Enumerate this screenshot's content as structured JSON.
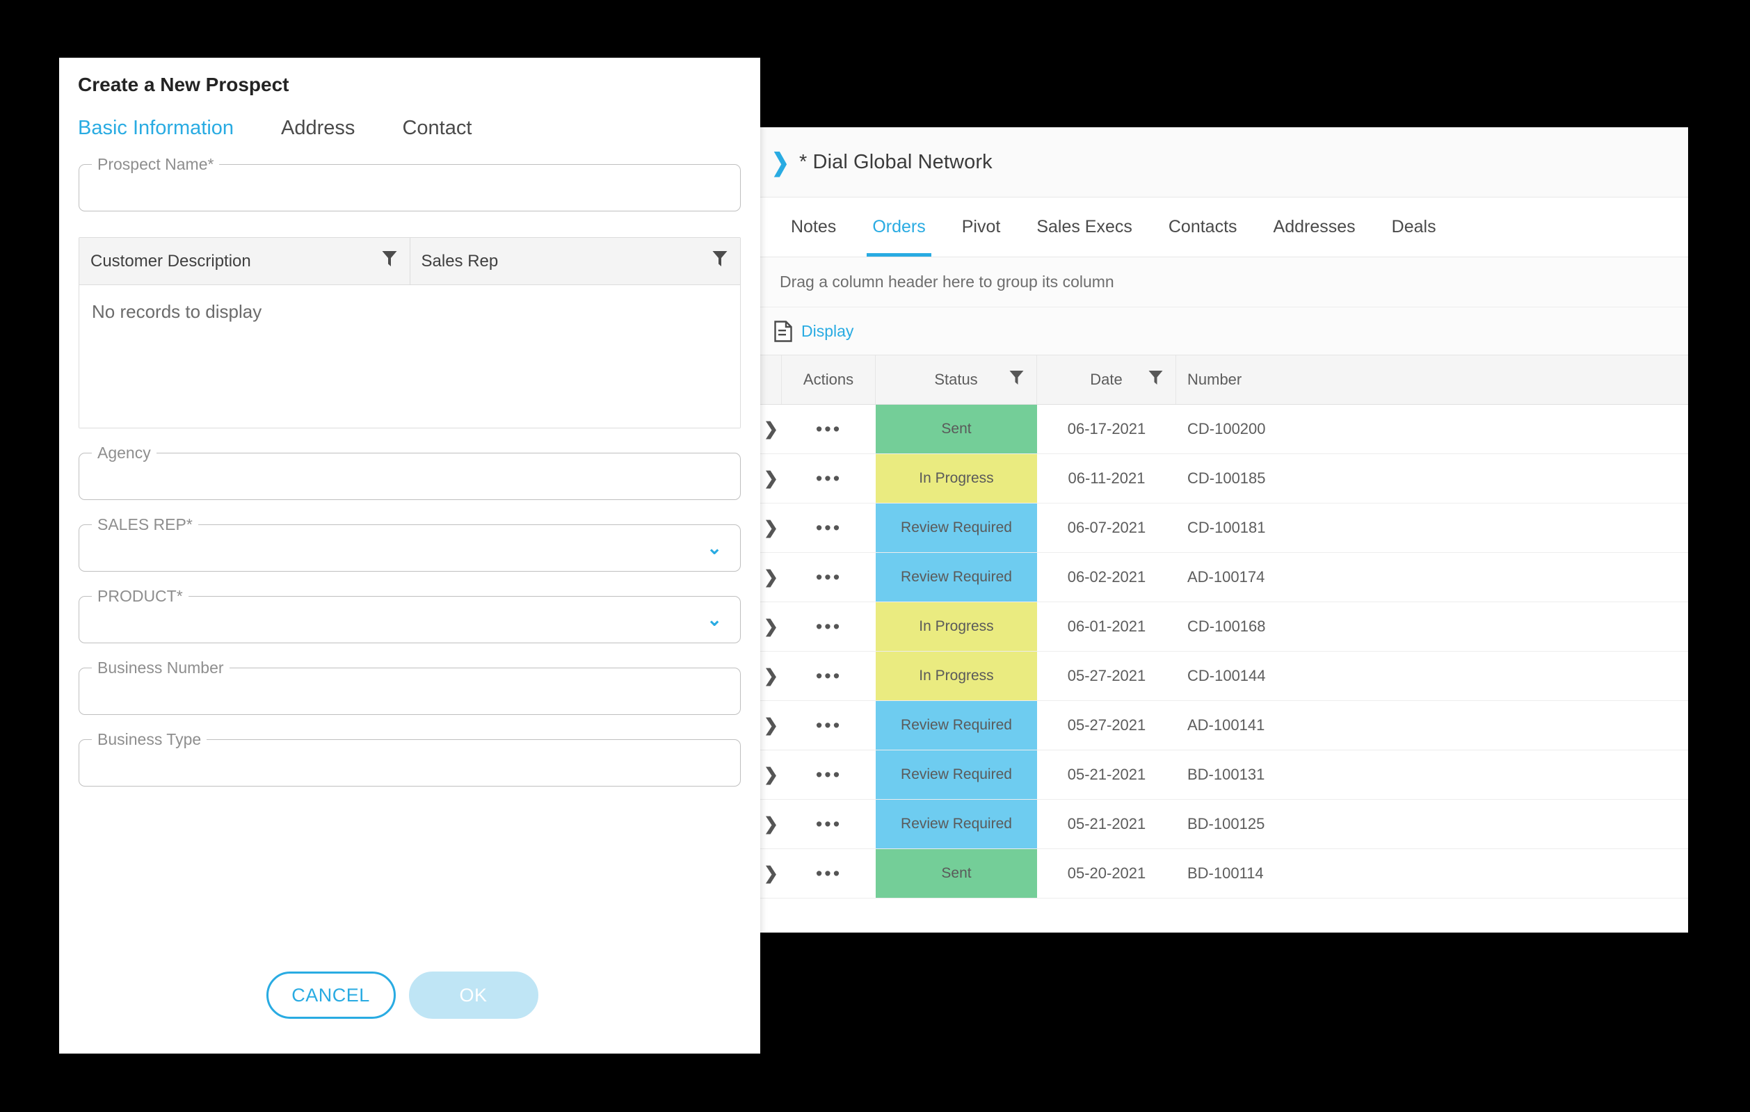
{
  "dialog": {
    "title": "Create a New Prospect",
    "tabs": [
      {
        "label": "Basic Information",
        "active": true
      },
      {
        "label": "Address",
        "active": false
      },
      {
        "label": "Contact",
        "active": false
      }
    ],
    "fields": {
      "prospect_name": {
        "label": "Prospect Name*",
        "value": ""
      },
      "agency": {
        "label": "Agency",
        "value": ""
      },
      "sales_rep": {
        "label": "SALES REP*",
        "value": ""
      },
      "product": {
        "label": "PRODUCT*",
        "value": ""
      },
      "business_number": {
        "label": "Business Number",
        "value": ""
      },
      "business_type": {
        "label": "Business Type",
        "value": ""
      }
    },
    "customer_grid": {
      "columns": [
        "Customer Description",
        "Sales Rep"
      ],
      "empty_message": "No records to display",
      "rows": []
    },
    "buttons": {
      "cancel": "CANCEL",
      "ok": "OK"
    }
  },
  "record_panel": {
    "header": {
      "title": "* Dial Global Network",
      "chevron": "chevron-right-icon"
    },
    "tabs": [
      {
        "label": "Notes",
        "active": false
      },
      {
        "label": "Orders",
        "active": true
      },
      {
        "label": "Pivot",
        "active": false
      },
      {
        "label": "Sales Execs",
        "active": false
      },
      {
        "label": "Contacts",
        "active": false
      },
      {
        "label": "Addresses",
        "active": false
      },
      {
        "label": "Deals",
        "active": false
      }
    ],
    "group_bar_text": "Drag a column header here to group its column",
    "toolbar": {
      "display_label": "Display",
      "display_icon": "document-icon"
    },
    "grid": {
      "columns": [
        {
          "label": "",
          "key": "expand",
          "filter": false
        },
        {
          "label": "Actions",
          "key": "actions",
          "filter": false
        },
        {
          "label": "Status",
          "key": "status",
          "filter": true
        },
        {
          "label": "Date",
          "key": "date",
          "filter": true
        },
        {
          "label": "Number",
          "key": "number",
          "filter": false
        }
      ],
      "rows": [
        {
          "actions": "•••",
          "status": "Sent",
          "date": "06-17-2021",
          "number": "CD-100200",
          "status_color": "#74ce98"
        },
        {
          "actions": "•••",
          "status": "In Progress",
          "date": "06-11-2021",
          "number": "CD-100185",
          "status_color": "#eaeb80"
        },
        {
          "actions": "•••",
          "status": "Review Required",
          "date": "06-07-2021",
          "number": "CD-100181",
          "status_color": "#6eccf0"
        },
        {
          "actions": "•••",
          "status": "Review Required",
          "date": "06-02-2021",
          "number": "AD-100174",
          "status_color": "#6eccf0"
        },
        {
          "actions": "•••",
          "status": "In Progress",
          "date": "06-01-2021",
          "number": "CD-100168",
          "status_color": "#eaeb80"
        },
        {
          "actions": "•••",
          "status": "In Progress",
          "date": "05-27-2021",
          "number": "CD-100144",
          "status_color": "#eaeb80"
        },
        {
          "actions": "•••",
          "status": "Review Required",
          "date": "05-27-2021",
          "number": "AD-100141",
          "status_color": "#6eccf0"
        },
        {
          "actions": "•••",
          "status": "Review Required",
          "date": "05-21-2021",
          "number": "BD-100131",
          "status_color": "#6eccf0"
        },
        {
          "actions": "•••",
          "status": "Review Required",
          "date": "05-21-2021",
          "number": "BD-100125",
          "status_color": "#6eccf0"
        },
        {
          "actions": "•••",
          "status": "Sent",
          "date": "05-20-2021",
          "number": "BD-100114",
          "status_color": "#74ce98"
        }
      ]
    }
  },
  "colors": {
    "accent": "#29abe2",
    "status_sent": "#74ce98",
    "status_in_progress": "#eaeb80",
    "status_review_required": "#6eccf0",
    "background": "#000000"
  }
}
